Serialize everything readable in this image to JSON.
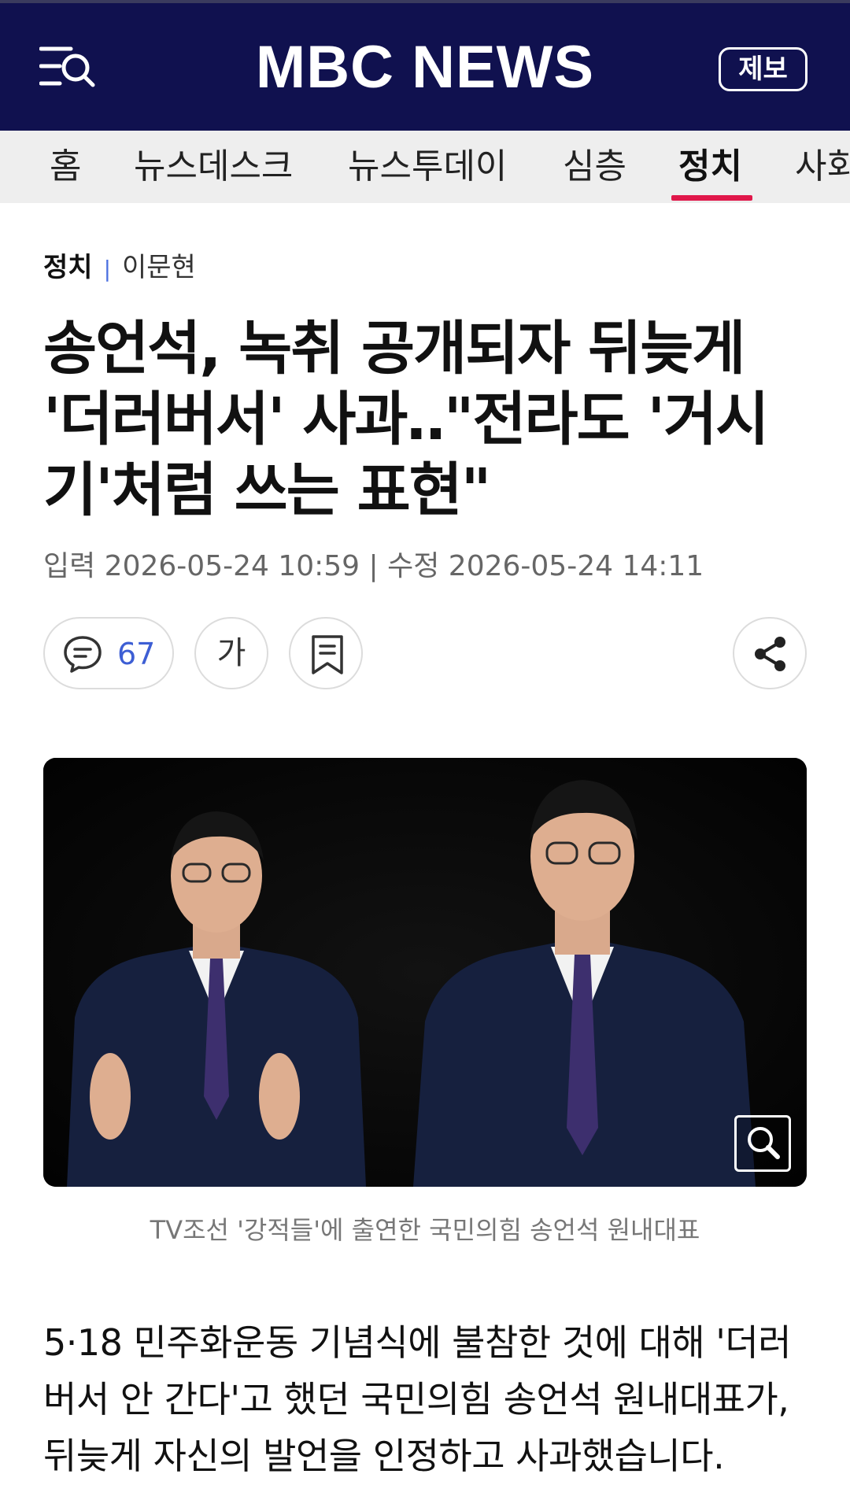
{
  "header": {
    "logo_text": "MBC NEWS",
    "report_label": "제보",
    "bg_color": "#10114f"
  },
  "nav": {
    "items": [
      {
        "label": "홈"
      },
      {
        "label": "뉴스데스크"
      },
      {
        "label": "뉴스투데이"
      },
      {
        "label": "심층"
      },
      {
        "label": "정치",
        "active": true
      },
      {
        "label": "사회"
      }
    ],
    "active_color": "#e0174a"
  },
  "article": {
    "section": "정치",
    "author": "이문현",
    "headline": "송언석, 녹취 공개되자 뒤늦게 '더러버서' 사과‥\"전라도 '거시기'처럼 쓰는 표현\"",
    "dates": "입력 2026-05-24 10:59 | 수정 2026-05-24 14:11",
    "comment_count": "67",
    "font_size_label": "가",
    "photo_caption": "TV조선 '강적들'에 출연한 국민의힘 송언석 원내대표",
    "body": "5·18 민주화운동 기념식에 불참한 것에 대해 '더러버서 안 간다'고 했던 국민의힘 송언석 원내대표가, 뒤늦게 자신의 발언을 인정하고 사과했습니다."
  },
  "icons": {
    "menu": "menu-search-icon",
    "comment": "comment-icon",
    "bookmark": "bookmark-icon",
    "share": "share-icon",
    "zoom": "zoom-icon"
  }
}
